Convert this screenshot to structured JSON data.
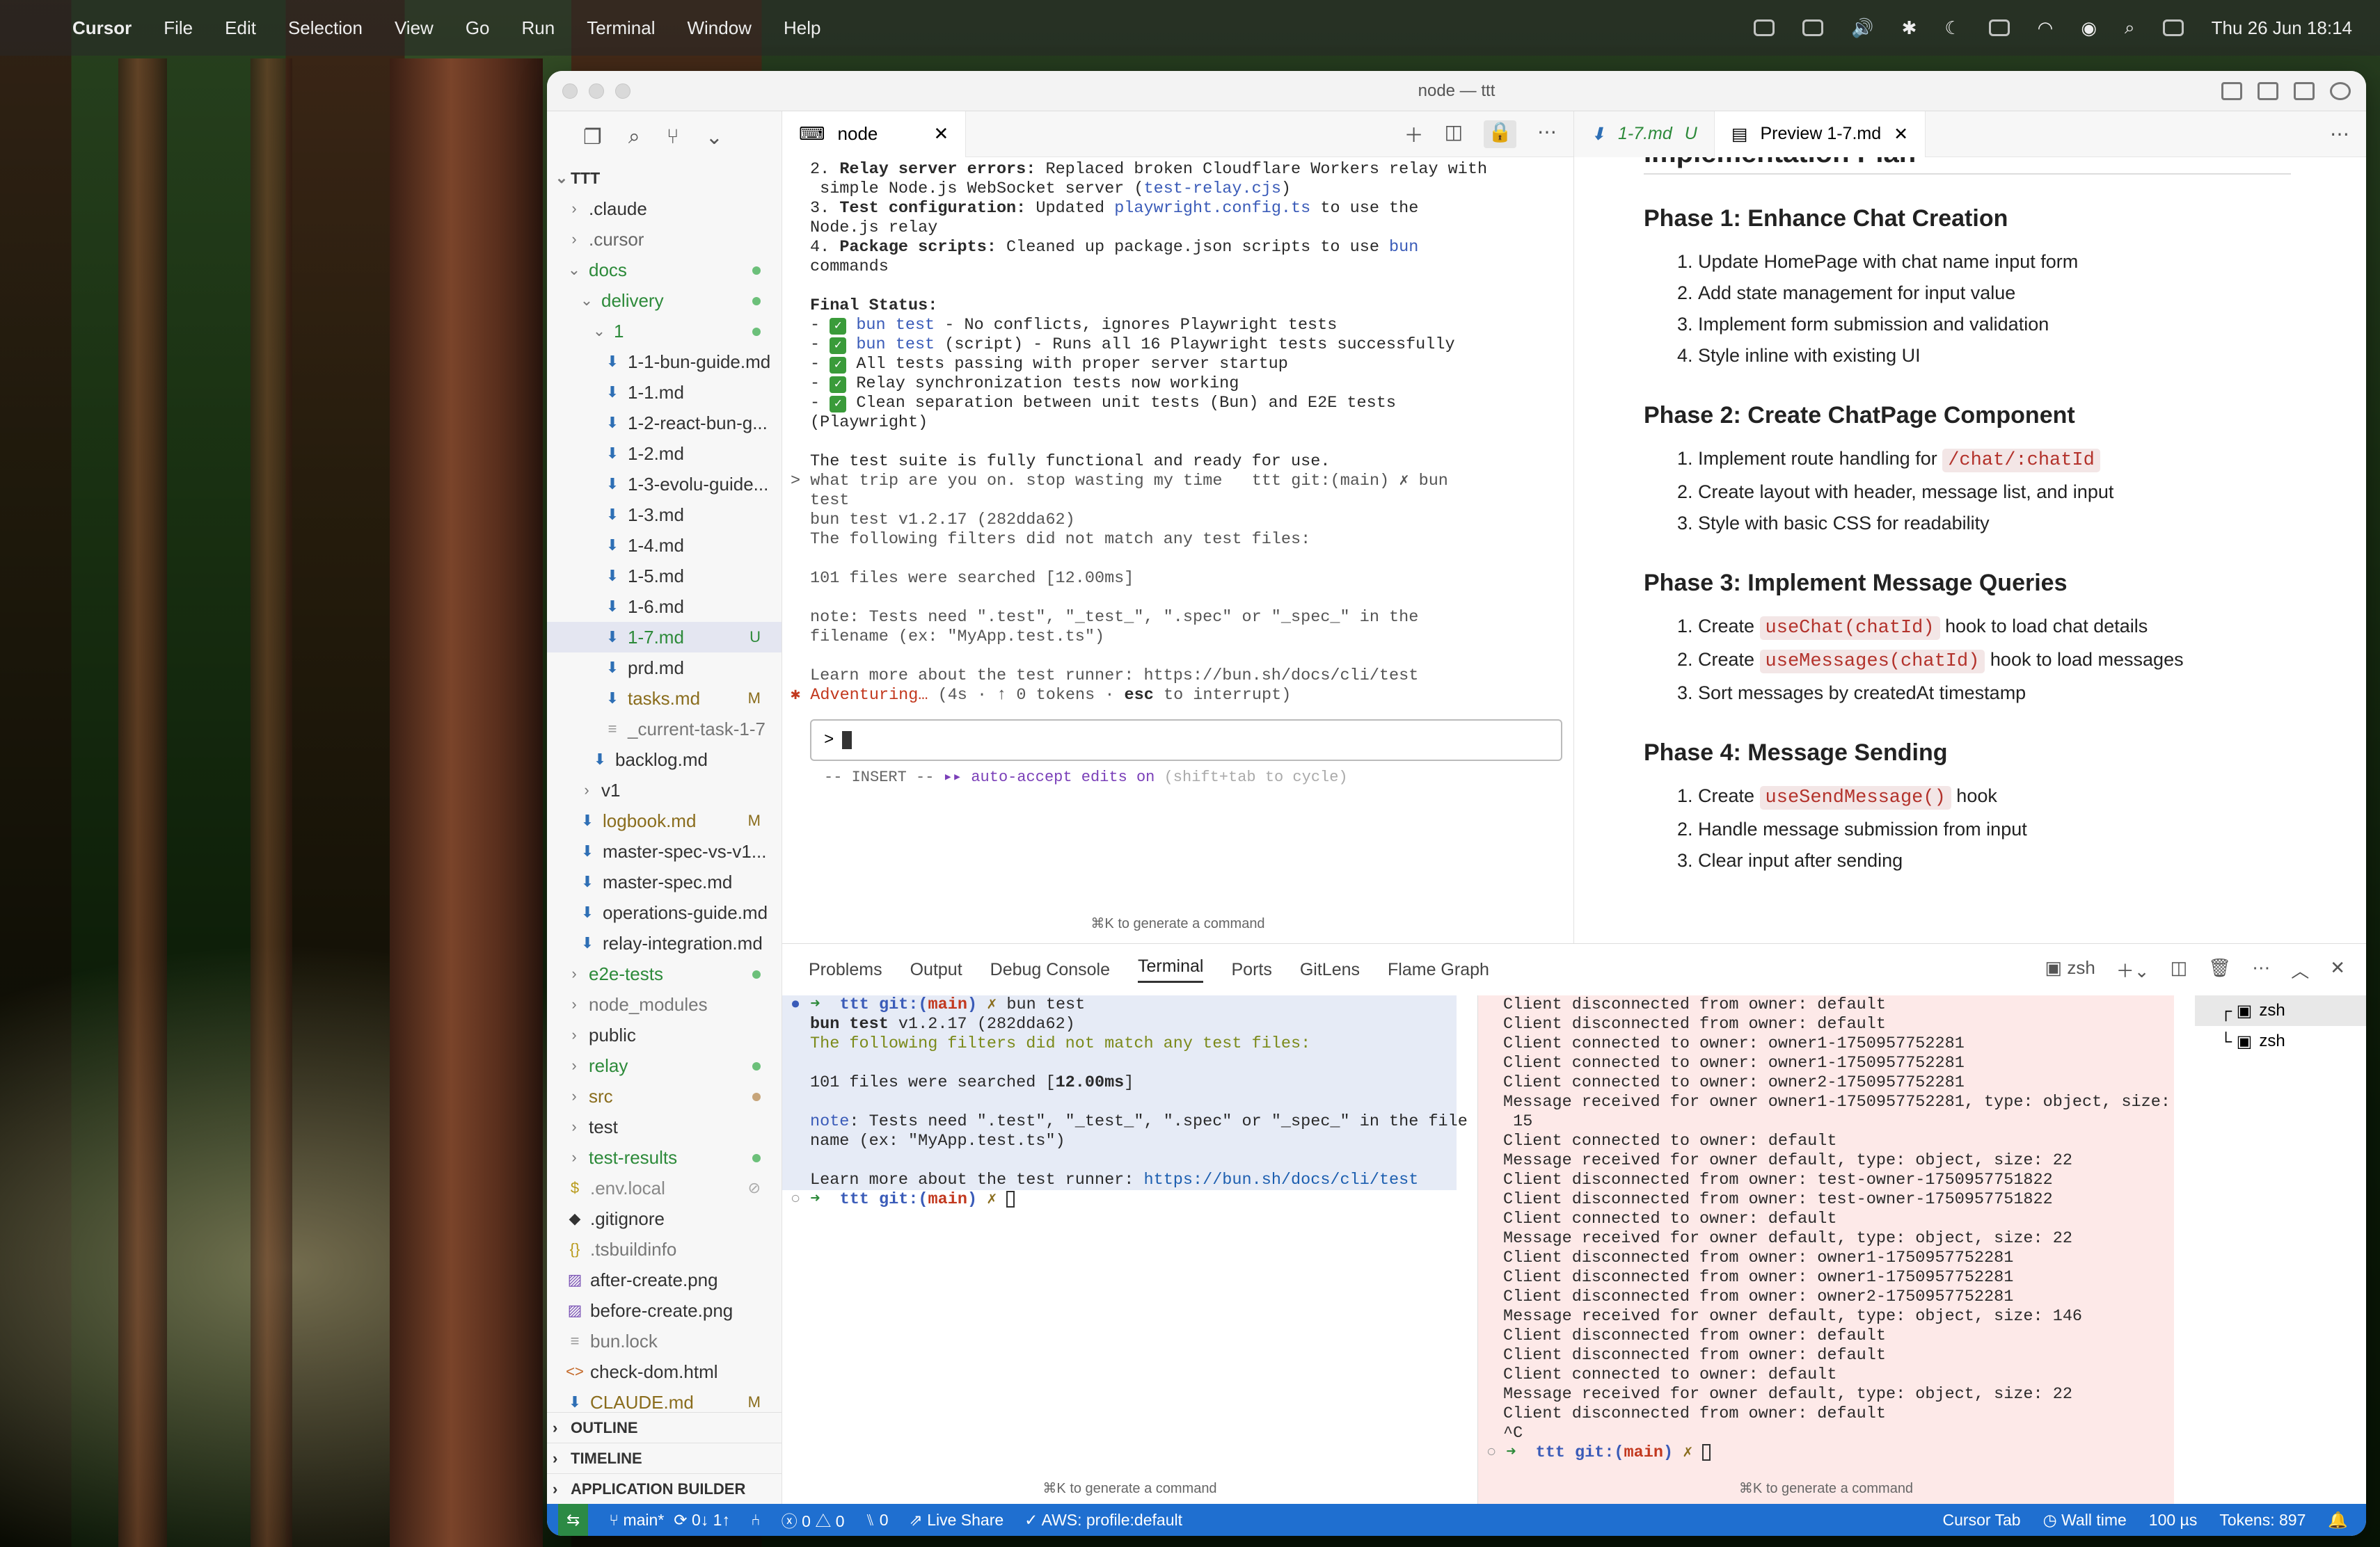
{
  "menubar": {
    "app": "Cursor",
    "items": [
      "File",
      "Edit",
      "Selection",
      "View",
      "Go",
      "Run",
      "Terminal",
      "Window",
      "Help"
    ],
    "datetime": "Thu 26 Jun  18:14"
  },
  "window": {
    "title": "node — ttt"
  },
  "sidebar": {
    "root": "TTT",
    "rows": [
      {
        "label": ".claude",
        "level": 1,
        "kind": "folder",
        "badge": "",
        "color": "#333"
      },
      {
        "label": ".cursor",
        "level": 1,
        "kind": "folder",
        "badge": "",
        "color": "#666"
      },
      {
        "label": "docs",
        "level": 1,
        "kind": "folder-open",
        "badge": "dot-green",
        "color": "#2d8a3a"
      },
      {
        "label": "delivery",
        "level": 2,
        "kind": "folder-open",
        "badge": "dot-green",
        "color": "#2d8a3a"
      },
      {
        "label": "1",
        "level": 3,
        "kind": "folder-open",
        "badge": "dot-green",
        "color": "#2d8a3a"
      },
      {
        "label": "1-1-bun-guide.md",
        "level": 4,
        "kind": "md",
        "badge": "",
        "color": "#333"
      },
      {
        "label": "1-1.md",
        "level": 4,
        "kind": "md",
        "badge": "",
        "color": "#333"
      },
      {
        "label": "1-2-react-bun-g...",
        "level": 4,
        "kind": "md",
        "badge": "",
        "color": "#333"
      },
      {
        "label": "1-2.md",
        "level": 4,
        "kind": "md",
        "badge": "",
        "color": "#333"
      },
      {
        "label": "1-3-evolu-guide...",
        "level": 4,
        "kind": "md",
        "badge": "",
        "color": "#333"
      },
      {
        "label": "1-3.md",
        "level": 4,
        "kind": "md",
        "badge": "",
        "color": "#333"
      },
      {
        "label": "1-4.md",
        "level": 4,
        "kind": "md",
        "badge": "",
        "color": "#333"
      },
      {
        "label": "1-5.md",
        "level": 4,
        "kind": "md",
        "badge": "",
        "color": "#333"
      },
      {
        "label": "1-6.md",
        "level": 4,
        "kind": "md",
        "badge": "",
        "color": "#333"
      },
      {
        "label": "1-7.md",
        "level": 4,
        "kind": "md",
        "badge": "U",
        "color": "#2d8a3a",
        "selected": true
      },
      {
        "label": "prd.md",
        "level": 4,
        "kind": "md",
        "badge": "",
        "color": "#333"
      },
      {
        "label": "tasks.md",
        "level": 4,
        "kind": "md",
        "badge": "M",
        "color": "#8a6d1d"
      },
      {
        "label": "_current-task-1-7",
        "level": 4,
        "kind": "file",
        "badge": "",
        "color": "#777"
      },
      {
        "label": "backlog.md",
        "level": 3,
        "kind": "md",
        "badge": "",
        "color": "#333"
      },
      {
        "label": "v1",
        "level": 2,
        "kind": "folder",
        "badge": "",
        "color": "#333"
      },
      {
        "label": "logbook.md",
        "level": 2,
        "kind": "md",
        "badge": "M",
        "color": "#8a6d1d"
      },
      {
        "label": "master-spec-vs-v1...",
        "level": 2,
        "kind": "md",
        "badge": "",
        "color": "#333"
      },
      {
        "label": "master-spec.md",
        "level": 2,
        "kind": "md",
        "badge": "",
        "color": "#333"
      },
      {
        "label": "operations-guide.md",
        "level": 2,
        "kind": "md",
        "badge": "",
        "color": "#333"
      },
      {
        "label": "relay-integration.md",
        "level": 2,
        "kind": "md",
        "badge": "",
        "color": "#333"
      },
      {
        "label": "e2e-tests",
        "level": 1,
        "kind": "folder",
        "badge": "dot-green",
        "color": "#2d8a3a"
      },
      {
        "label": "node_modules",
        "level": 1,
        "kind": "folder",
        "badge": "",
        "color": "#777"
      },
      {
        "label": "public",
        "level": 1,
        "kind": "folder",
        "badge": "",
        "color": "#333"
      },
      {
        "label": "relay",
        "level": 1,
        "kind": "folder",
        "badge": "dot-green",
        "color": "#2d8a3a"
      },
      {
        "label": "src",
        "level": 1,
        "kind": "folder",
        "badge": "dot-brown",
        "color": "#8a6d1d"
      },
      {
        "label": "test",
        "level": 1,
        "kind": "folder",
        "badge": "",
        "color": "#333"
      },
      {
        "label": "test-results",
        "level": 1,
        "kind": "folder",
        "badge": "dot-green",
        "color": "#2d8a3a"
      },
      {
        "label": ".env.local",
        "level": 1,
        "kind": "env",
        "badge": "ignored",
        "color": "#888"
      },
      {
        "label": ".gitignore",
        "level": 1,
        "kind": "git",
        "badge": "",
        "color": "#333"
      },
      {
        "label": ".tsbuildinfo",
        "level": 1,
        "kind": "json",
        "badge": "",
        "color": "#777"
      },
      {
        "label": "after-create.png",
        "level": 1,
        "kind": "img",
        "badge": "",
        "color": "#333"
      },
      {
        "label": "before-create.png",
        "level": 1,
        "kind": "img",
        "badge": "",
        "color": "#333"
      },
      {
        "label": "bun.lock",
        "level": 1,
        "kind": "file",
        "badge": "",
        "color": "#777"
      },
      {
        "label": "check-dom.html",
        "level": 1,
        "kind": "html",
        "badge": "",
        "color": "#333"
      },
      {
        "label": "CLAUDE.md",
        "level": 1,
        "kind": "md",
        "badge": "M",
        "color": "#8a6d1d"
      }
    ],
    "sections": [
      "OUTLINE",
      "TIMELINE",
      "APPLICATION BUILDER"
    ]
  },
  "editor": {
    "tab_label": "node",
    "hint": "⌘K to generate a command",
    "input_prompt": ">",
    "mode_line": {
      "insert": "-- INSERT --",
      "arrows": "▸▸",
      "auto": "auto-accept edits on",
      "cycle": "(shift+tab to cycle)"
    },
    "adventuring": {
      "star": "✱",
      "word": "Adventuring…",
      "rest": " (4s · ↑ 0 tokens · ",
      "esc": "esc",
      "tail": " to interrupt)"
    }
  },
  "preview": {
    "tab1": "1-7.md",
    "tab1_badge": "U",
    "tab2": "Preview 1-7.md",
    "heading_partial": "Implementation Plan",
    "phases": [
      {
        "title": "Phase 1: Enhance Chat Creation",
        "items": [
          [
            {
              "t": "Update HomePage with chat name input form"
            }
          ],
          [
            {
              "t": "Add state management for input value"
            }
          ],
          [
            {
              "t": "Implement form submission and validation"
            }
          ],
          [
            {
              "t": "Style inline with existing UI"
            }
          ]
        ]
      },
      {
        "title": "Phase 2: Create ChatPage Component",
        "items": [
          [
            {
              "t": "Implement route handling for "
            },
            {
              "c": "/chat/:chatId"
            }
          ],
          [
            {
              "t": "Create layout with header, message list, and input"
            }
          ],
          [
            {
              "t": "Style with basic CSS for readability"
            }
          ]
        ]
      },
      {
        "title": "Phase 3: Implement Message Queries",
        "items": [
          [
            {
              "t": "Create "
            },
            {
              "c": "useChat(chatId)"
            },
            {
              "t": " hook to load chat details"
            }
          ],
          [
            {
              "t": "Create "
            },
            {
              "c": "useMessages(chatId)"
            },
            {
              "t": " hook to load messages"
            }
          ],
          [
            {
              "t": "Sort messages by createdAt timestamp"
            }
          ]
        ]
      },
      {
        "title": "Phase 4: Message Sending",
        "items": [
          [
            {
              "t": "Create "
            },
            {
              "c": "useSendMessage()"
            },
            {
              "t": " hook"
            }
          ],
          [
            {
              "t": "Handle message submission from input"
            }
          ],
          [
            {
              "t": "Clear input after sending"
            }
          ]
        ]
      }
    ]
  },
  "panel": {
    "tabs": [
      "Problems",
      "Output",
      "Debug Console",
      "Terminal",
      "Ports",
      "GitLens",
      "Flame Graph"
    ],
    "active_tab": "Terminal",
    "shell": "zsh",
    "hint_left": "⌘K to generate a command",
    "hint_right": "⌘K to generate a command",
    "terminals": [
      "zsh",
      "zsh"
    ]
  },
  "right_terminal_lines": [
    "Client disconnected from owner: default",
    "Client disconnected from owner: default",
    "Client connected to owner: owner1-1750957752281",
    "Client connected to owner: owner1-1750957752281",
    "Client connected to owner: owner2-1750957752281",
    "Message received for owner owner1-1750957752281, type: object, size:",
    " 15",
    "Client connected to owner: default",
    "Message received for owner default, type: object, size: 22",
    "Client disconnected from owner: test-owner-1750957751822",
    "Client disconnected from owner: test-owner-1750957751822",
    "Client connected to owner: default",
    "Message received for owner default, type: object, size: 22",
    "Client disconnected from owner: owner1-1750957752281",
    "Client disconnected from owner: owner1-1750957752281",
    "Client disconnected from owner: owner2-1750957752281",
    "Message received for owner default, type: object, size: 146",
    "Client disconnected from owner: default",
    "Client disconnected from owner: default",
    "Client connected to owner: default",
    "Message received for owner default, type: object, size: 22",
    "Client disconnected from owner: default",
    "^C"
  ],
  "statusbar": {
    "branch": "main*",
    "sync": "0↓ 1↑",
    "errors": "0",
    "warnings": "0",
    "ports": "0",
    "live_share": "Live Share",
    "aws": "AWS: profile:default",
    "cursor_tab": "Cursor Tab",
    "wall_time": "Wall time",
    "micro": "100 µs",
    "tokens": "Tokens: 897"
  },
  "colors": {
    "accent": "#1f6fd0",
    "git_added": "#2d8a3a",
    "git_modified": "#8a6d1d",
    "code_red": "#b3322b"
  }
}
